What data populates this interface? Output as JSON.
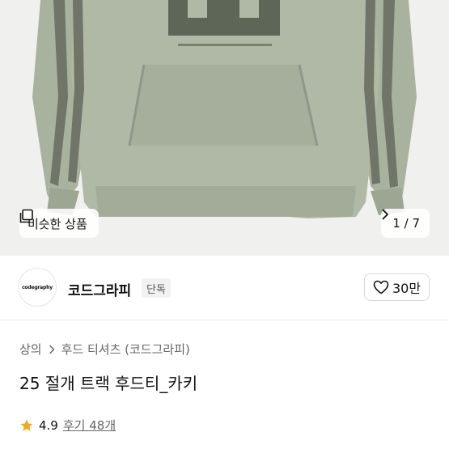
{
  "hero": {
    "image_alt": "sage green hoodie",
    "similar_label": "비슷한 상품",
    "pager_text": "1 / 7",
    "garment_color": "#a9b29f",
    "stripe_color": "#6f7668"
  },
  "brand": {
    "logo_text": "codegraphy",
    "name": "코드그라피",
    "badge": "단독",
    "like_count": "30만"
  },
  "product": {
    "breadcrumb": [
      "상의",
      "후드 티셔츠 (코드그라피)"
    ],
    "title": "25 절개 트랙 후드티_카키",
    "rating": "4.9",
    "reviews": "후기 48개",
    "star_color": "#f5a623"
  }
}
